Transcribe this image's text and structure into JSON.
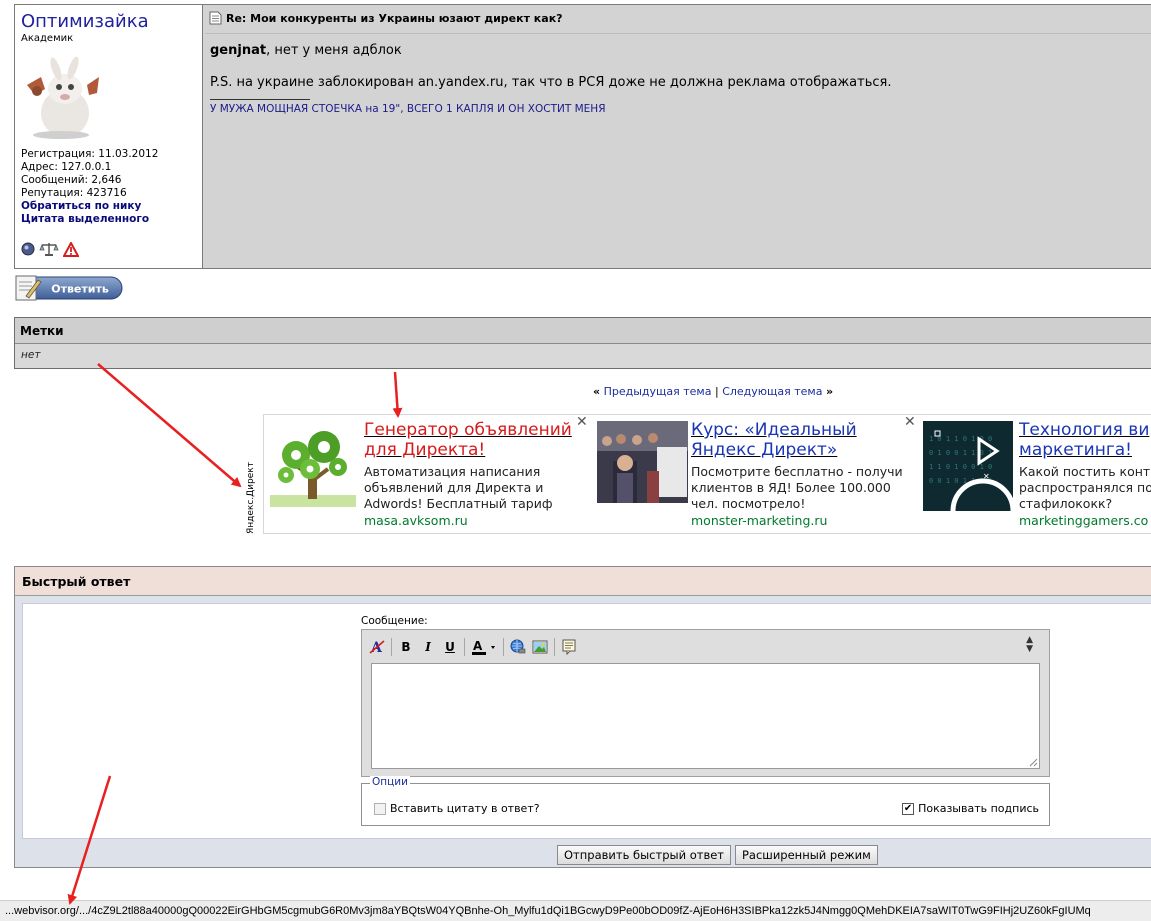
{
  "post": {
    "username": "Оптимизайка",
    "rank": "Академик",
    "info": {
      "registration": "Регистрация: 11.03.2012",
      "address": "Адрес: 127.0.0.1",
      "messages": "Сообщений: 2,646",
      "reputation": "Репутация: 423716",
      "mention_link": "Обратиться по нику",
      "quote_link": "Цитата выделенного"
    },
    "title": "Re: Мои конкуренты из Украины юзают директ как?",
    "reply_to_user": "genjnat",
    "text1_rest": ", нет у меня адблок",
    "text2": "P.S. на украине заблокирован an.yandex.ru, так что в РСЯ доже не должна реклама отображаться.",
    "signature": "У МУЖА МОЩНАЯ СТОЕЧКА на 19\", ВСЕГО 1 КАПЛЯ И ОН ХОСТИТ МЕНЯ"
  },
  "reply_button": "Ответить",
  "tags": {
    "header": "Метки",
    "value": "нет"
  },
  "thread_nav": {
    "prev": "Предыдущая тема",
    "separator": "|",
    "next": "Следующая тема",
    "left_arrows": "«",
    "right_arrows": "»"
  },
  "ads": {
    "provider_label": "Яндекс.Директ",
    "items": [
      {
        "title_line1": "Генератор объявлений",
        "title_line2": "для Директа!",
        "desc": "Автоматизация написания объявлений для Директа и Adwords! Бесплатный тариф",
        "domain": "masa.avksom.ru",
        "title_color": "#d71a1a"
      },
      {
        "title_line1": "Курс: «Идеальный",
        "title_line2": "Яндекс Директ»",
        "desc": "Посмотрите бесплатно - получи клиентов в ЯД! Более 100.000 чел. посмотрело!",
        "domain": "monster-marketing.ru",
        "title_color": "#1a36b4"
      },
      {
        "title_line1": "Технология ви",
        "title_line2": "маркетинга!",
        "desc": "Какой постить конте распространялся по стафилококк?",
        "domain": "marketinggamers.co",
        "title_color": "#1a36b4"
      }
    ],
    "close_symbol": "✕"
  },
  "quick_reply": {
    "header": "Быстрый ответ",
    "message_label": "Сообщение:",
    "toolbar": {
      "bold": "B",
      "italic": "I",
      "underline": "U",
      "font_color": "A"
    },
    "options_legend": "Опции",
    "option_quote": "Вставить цитату в ответ?",
    "option_signature": "Показывать подпись",
    "submit_button": "Отправить быстрый ответ",
    "advanced_button": "Расширенный режим"
  },
  "statusbar": {
    "url": "...webvisor.org/.../4cZ9L2tl88a40000gQ00022EirGHbGM5cgmubG6R0Mv3jm8aYBQtsW04YQBnhe-Oh_Mylfu1dQi1BGcwyD9Pe00bOD09fZ-AjEoH6H3SIBPka12zk5J4Nmgg0QMehDKEIA7saWIT0TwG9FIHj2UZ60kFgIUMq"
  },
  "colors": {
    "annotation_arrow": "#e8201f",
    "username": "#22229c",
    "domain_green": "#007a2d"
  }
}
